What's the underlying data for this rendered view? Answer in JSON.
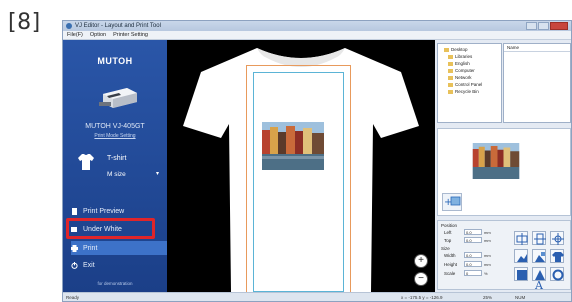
{
  "step_label": "[8]",
  "window": {
    "title": "VJ Editor - Layout and Print Tool",
    "menu": [
      "File(F)",
      "Option",
      "Printer Setting"
    ]
  },
  "sidebar": {
    "logo": "MUTOH",
    "printer_model": "MUTOH VJ-405GT",
    "print_mode_link": "Print Mode Setting",
    "shirt_type": "T-shirt",
    "shirt_size": "M size",
    "menu_items": [
      {
        "label": "Print Preview",
        "icon": "preview-icon"
      },
      {
        "label": "Under White",
        "icon": "white-layer-icon"
      },
      {
        "label": "Print",
        "icon": "printer-icon"
      },
      {
        "label": "Exit",
        "icon": "power-icon"
      }
    ],
    "demo_note": "for demonstration",
    "highlight_color": "#e0252a"
  },
  "tree": {
    "items": [
      "Desktop",
      "Libraries",
      "English",
      "Computer",
      "Network",
      "Control Panel",
      "Recycle Bin"
    ]
  },
  "file_list": {
    "header": "Name"
  },
  "controls": {
    "position_label": "Position",
    "left_label": "Left",
    "left_value": "0.0",
    "top_label": "Top",
    "top_value": "0.0",
    "size_label": "Size",
    "width_label": "Width",
    "width_value": "0.0",
    "height_label": "Height",
    "height_value": "0.0",
    "scale_label": "Scale",
    "scale_value": "0",
    "unit_mm": "mm",
    "unit_pct": "%"
  },
  "status": {
    "left": "Ready",
    "coords": "x = -175.5 y = -126.9",
    "zoom": "25%",
    "mode": "NUM"
  },
  "colors": {
    "sidebar_blue": "#2a56a8",
    "canvas_bg": "#000000",
    "print_area_outer": "#e89a5c",
    "print_area_inner": "#5bb4d6"
  }
}
